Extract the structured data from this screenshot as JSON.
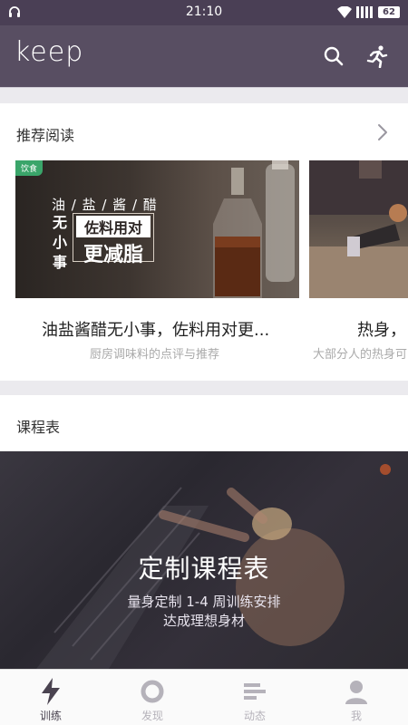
{
  "status_bar": {
    "time": "21:10",
    "battery": "62"
  },
  "app_bar": {
    "logo": "keep"
  },
  "recommended": {
    "title": "推荐阅读",
    "articles": [
      {
        "tag": "饮食",
        "image_text": {
          "line1": "油 / 盐 / 酱 / 醋",
          "line2": "无小事",
          "box_top": "佐料用对",
          "box_bottom": "更减脂"
        },
        "title": "油盐酱醋无小事，佐料用对更...",
        "subtitle": "厨房调味料的点评与推荐"
      },
      {
        "title": "热身，",
        "subtitle": "大部分人的热身可"
      }
    ]
  },
  "schedule": {
    "title": "课程表",
    "banner_title": "定制课程表",
    "banner_line1": "量身定制 1-4 周训练安排",
    "banner_line2": "达成理想身材"
  },
  "tabs": [
    {
      "label": "训练",
      "icon": "lightning-icon",
      "active": true
    },
    {
      "label": "发现",
      "icon": "ring-icon",
      "active": false
    },
    {
      "label": "动态",
      "icon": "bars-icon",
      "active": false
    },
    {
      "label": "我",
      "icon": "person-icon",
      "active": false
    }
  ],
  "colors": {
    "header": "#584e62",
    "status": "#4a3f55",
    "tag": "#3aa56a"
  }
}
